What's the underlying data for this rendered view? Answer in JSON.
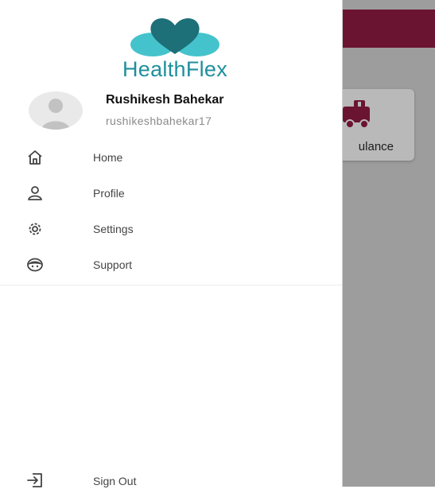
{
  "app": {
    "name": "HealthFlex"
  },
  "colors": {
    "brand_teal": "#1f8f9c",
    "brand_heart_light": "#45c3cc",
    "brand_heart_dark": "#1d6f78",
    "background_appbar": "#6b1431",
    "background_icon": "#6b1431"
  },
  "user": {
    "name": "Rushikesh Bahekar",
    "handle": "rushikeshbahekar17",
    "avatar_icon": "person-avatar-icon"
  },
  "menu": {
    "items": [
      {
        "label": "Home",
        "icon": "home-icon"
      },
      {
        "label": "Profile",
        "icon": "profile-icon"
      },
      {
        "label": "Settings",
        "icon": "settings-icon"
      },
      {
        "label": "Support",
        "icon": "support-icon"
      }
    ],
    "signout": {
      "label": "Sign Out",
      "icon": "sign-out-icon"
    }
  },
  "background": {
    "card_label": "ulance",
    "card_icon": "ambulance-icon"
  }
}
